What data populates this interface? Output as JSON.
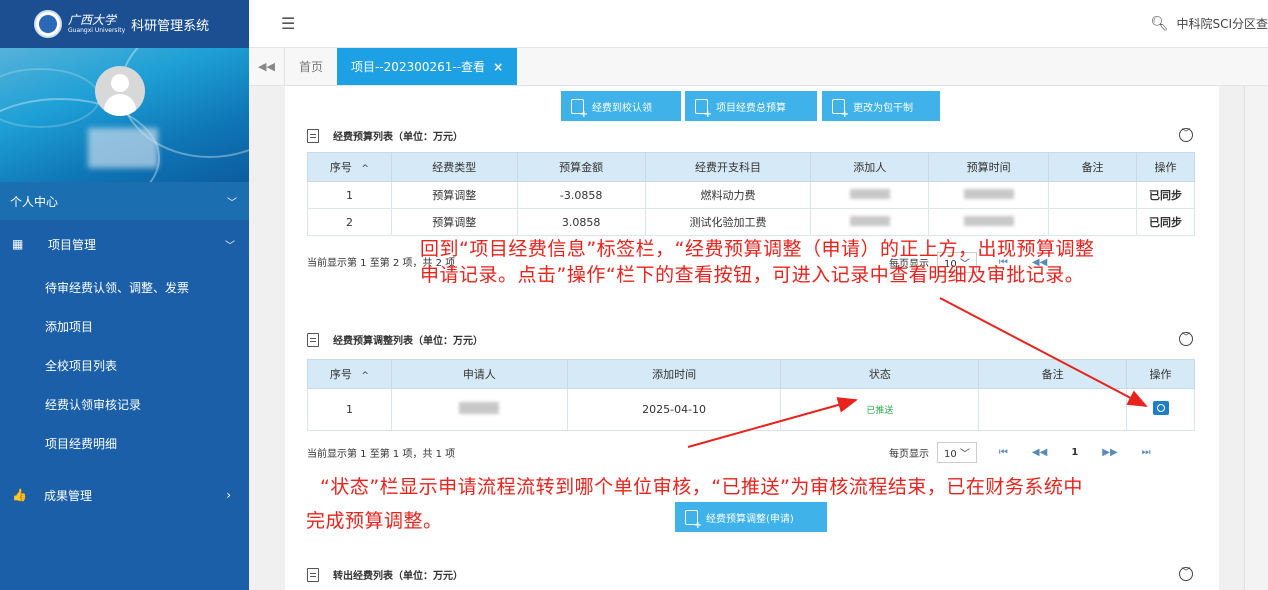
{
  "sidebar": {
    "logo_school": "广西大学",
    "logo_school_en": "Guangxi University",
    "logo_system": "科研管理系统",
    "personal_center": "个人中心",
    "project_mgmt": "项目管理",
    "sub_items": [
      "待审经费认领、调整、发票",
      "添加项目",
      "全校项目列表",
      "经费认领审核记录",
      "项目经费明细"
    ],
    "result_mgmt": "成果管理"
  },
  "topbar": {
    "right_text": "中科院SCI分区查"
  },
  "tabs": {
    "home": "首页",
    "active": "项目--202300261--查看",
    "close": "×"
  },
  "buttons": {
    "fund_claim": "经费到校认领",
    "total_budget": "项目经费总预算",
    "change_lump": "更改为包干制",
    "budget_adjust_apply": "经费预算调整(申请)"
  },
  "budget_list": {
    "title": "经费预算列表（单位：万元）",
    "headers": [
      "序号",
      "经费类型",
      "预算金额",
      "经费开支科目",
      "添加人",
      "预算时间",
      "备注",
      "操作"
    ],
    "sort_icon": "^",
    "rows": [
      {
        "no": "1",
        "type": "预算调整",
        "amount": "-3.0858",
        "subject": "燃料动力费",
        "remark": "",
        "op": "已同步"
      },
      {
        "no": "2",
        "type": "预算调整",
        "amount": "3.0858",
        "subject": "测试化验加工费",
        "remark": "",
        "op": "已同步"
      }
    ],
    "footer": "当前显示第 1 至第 2 项，共 2 项",
    "per_page_label": "每页显示",
    "per_page": "10"
  },
  "adjust_list": {
    "title": "经费预算调整列表（单位：万元）",
    "headers": [
      "序号",
      "申请人",
      "添加时间",
      "状态",
      "备注",
      "操作"
    ],
    "sort_icon": "^",
    "rows": [
      {
        "no": "1",
        "date": "2025-04-10",
        "status": "已推送",
        "remark": ""
      }
    ],
    "footer": "当前显示第 1 至第 1 项，共 1 项",
    "per_page_label": "每页显示",
    "per_page": "10",
    "page": "1"
  },
  "transfer_list": {
    "title": "转出经费列表（单位：万元）"
  },
  "pager_icons": {
    "first": "⏮",
    "prev": "◀◀",
    "next": "▶▶",
    "last": "⏭"
  },
  "annotations": {
    "top_line1": "回到“项目经费信息”标签栏，“经费预算调整（申请）的正上方，出现预算调整",
    "top_line2": "申请记录。点击”操作“栏下的查看按钮，可进入记录中查看明细及审批记录。",
    "bottom_line1": "“状态”栏显示申请流程流转到哪个单位审核，“已推送”为审核流程结束，已在财务系统中",
    "bottom_line2": "完成预算调整。"
  },
  "colors": {
    "sidebar": "#1a5fa8",
    "accent": "#1ea0e4",
    "button": "#3fb2ea",
    "annotation": "#e8231d",
    "status_green": "#2aa54a"
  }
}
